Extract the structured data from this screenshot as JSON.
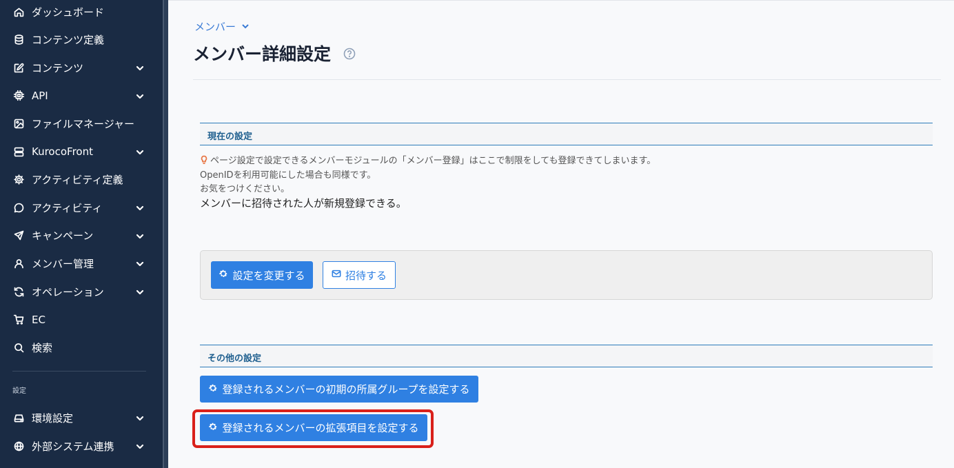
{
  "sidebar": {
    "items": [
      {
        "label": "ダッシュボード",
        "icon": "home-icon",
        "chevron": false
      },
      {
        "label": "コンテンツ定義",
        "icon": "database-icon",
        "chevron": false
      },
      {
        "label": "コンテンツ",
        "icon": "edit-icon",
        "chevron": true
      },
      {
        "label": "API",
        "icon": "chip-icon",
        "chevron": true
      },
      {
        "label": "ファイルマネージャー",
        "icon": "image-icon",
        "chevron": false
      },
      {
        "label": "KurocoFront",
        "icon": "server-icon",
        "chevron": true
      },
      {
        "label": "アクティビティ定義",
        "icon": "gear-icon",
        "chevron": false
      },
      {
        "label": "アクティビティ",
        "icon": "chat-icon",
        "chevron": true
      },
      {
        "label": "キャンペーン",
        "icon": "send-icon",
        "chevron": true
      },
      {
        "label": "メンバー管理",
        "icon": "user-icon",
        "chevron": true
      },
      {
        "label": "オペレーション",
        "icon": "refresh-icon",
        "chevron": true
      },
      {
        "label": "EC",
        "icon": "cart-icon",
        "chevron": false
      },
      {
        "label": "検索",
        "icon": "search-icon",
        "chevron": false
      }
    ],
    "settings_label": "設定",
    "settings_items": [
      {
        "label": "環境設定",
        "icon": "drive-icon",
        "chevron": true
      },
      {
        "label": "外部システム連携",
        "icon": "globe-icon",
        "chevron": true
      }
    ]
  },
  "breadcrumb": {
    "label": "メンバー"
  },
  "page": {
    "title": "メンバー詳細設定"
  },
  "current_settings": {
    "heading": "現在の設定",
    "notes": [
      "ページ設定で設定できるメンバーモジュールの「メンバー登録」はここで制限をしても登録できてしまいます。",
      "OpenIDを利用可能にした場合も同様です。",
      "お気をつけください。"
    ],
    "status": "メンバーに招待された人が新規登録できる。",
    "change_button": "設定を変更する",
    "invite_button": "招待する"
  },
  "other_settings": {
    "heading": "その他の設定",
    "group_button": "登録されるメンバーの初期の所属グループを設定する",
    "extension_button": "登録されるメンバーの拡張項目を設定する"
  },
  "colors": {
    "sidebar_bg": "#1a2b44",
    "accent": "#2f80e2",
    "section_border": "#2b7bb9",
    "highlight": "#d9201a"
  }
}
